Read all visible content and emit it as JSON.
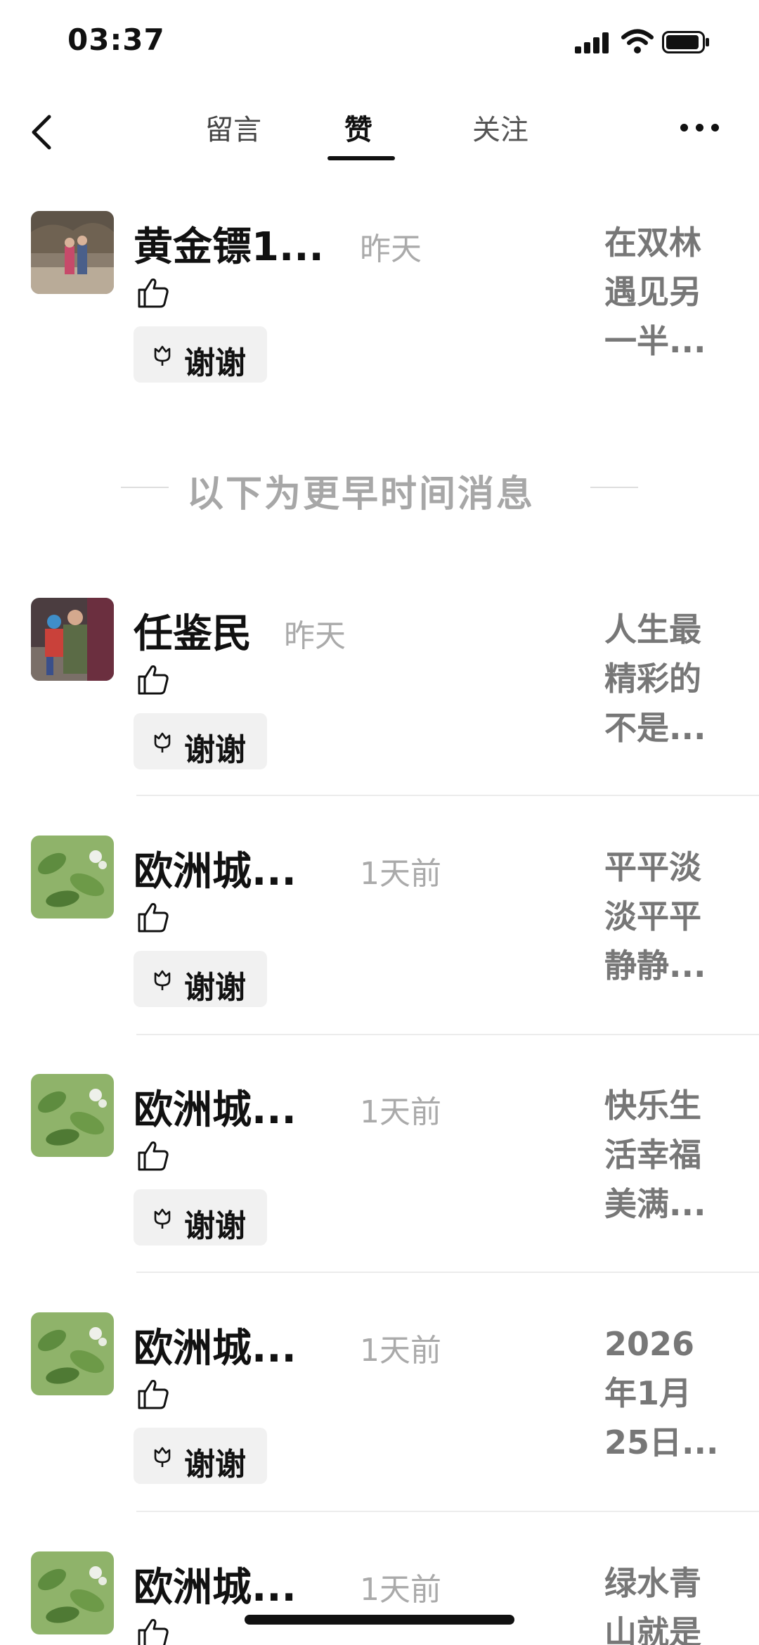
{
  "status": {
    "time": "03:37"
  },
  "nav": {
    "tabs": [
      {
        "label": "留言"
      },
      {
        "label": "赞"
      },
      {
        "label": "关注"
      }
    ],
    "active_tab": "赞"
  },
  "separator_text": "以下为更早时间消息",
  "thanks_label": "谢谢",
  "items": [
    {
      "name": "黄金镖1...",
      "time": "昨天",
      "preview": [
        "在双林",
        "遇见另",
        "一半..."
      ],
      "avatar": "couple-photo"
    },
    {
      "name": "任鉴民",
      "time": "昨天",
      "preview": [
        "人生最",
        "精彩的",
        "不是..."
      ],
      "avatar": "man-child-photo"
    },
    {
      "name": "欧洲城...",
      "time": "1天前",
      "preview": [
        "平平淡",
        "淡平平",
        "静静..."
      ],
      "avatar": "green-plant-photo"
    },
    {
      "name": "欧洲城...",
      "time": "1天前",
      "preview": [
        "快乐生",
        "活幸福",
        "美满..."
      ],
      "avatar": "green-plant-photo"
    },
    {
      "name": "欧洲城...",
      "time": "1天前",
      "preview": [
        "2026",
        "年1月",
        "25日..."
      ],
      "avatar": "green-plant-photo"
    },
    {
      "name": "欧洲城...",
      "time": "1天前",
      "preview": [
        "绿水青",
        "山就是"
      ],
      "avatar": "green-plant-photo"
    }
  ]
}
